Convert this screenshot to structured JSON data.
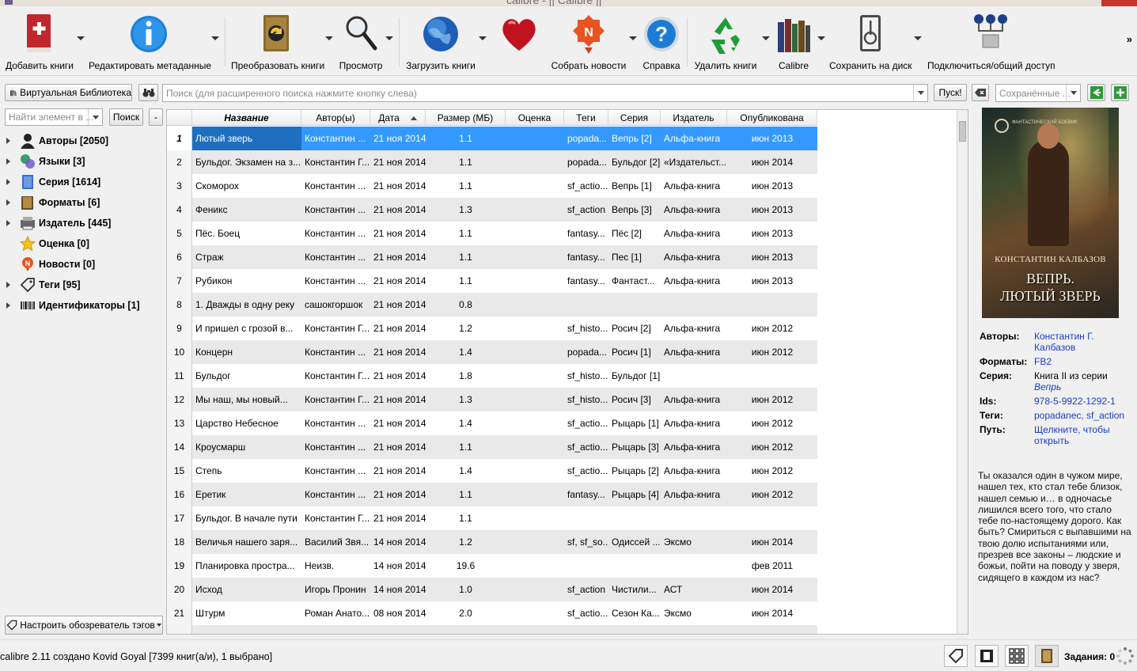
{
  "window": {
    "title": "calibre - || Calibre ||"
  },
  "toolbar": {
    "add_books": "Добавить книги",
    "edit_metadata": "Редактировать метаданные",
    "convert_books": "Преобразовать книги",
    "view": "Просмотр",
    "get_books": "Загрузить книги",
    "fetch_news": "Собрать новости",
    "help": "Справка",
    "remove_books": "Удалить книги",
    "calibre": "Calibre",
    "save_to_disk": "Сохранить на диск",
    "connect_share": "Подключиться/общий доступ",
    "more": "»"
  },
  "search": {
    "virtual_library": "Виртуальная Библиотека",
    "placeholder": "Поиск (для расширенного поиска нажмите кнопку слева)",
    "go": "Пуск!",
    "saved_placeholder": "Сохранённые ..."
  },
  "tag_browser": {
    "find_placeholder": "Найти элемент в ...",
    "find_button": "Поиск",
    "collapse_button": "-",
    "items": [
      {
        "label": "Авторы [2050]",
        "icon": "user-icon",
        "expandable": true
      },
      {
        "label": "Языки [3]",
        "icon": "languages-icon",
        "expandable": true
      },
      {
        "label": "Серия [1614]",
        "icon": "series-icon",
        "expandable": true
      },
      {
        "label": "Форматы [6]",
        "icon": "book-icon",
        "expandable": true
      },
      {
        "label": "Издатель [445]",
        "icon": "publisher-icon",
        "expandable": true
      },
      {
        "label": "Оценка [0]",
        "icon": "star-icon",
        "expandable": false
      },
      {
        "label": "Новости [0]",
        "icon": "news-icon",
        "expandable": false
      },
      {
        "label": "Теги [95]",
        "icon": "tag-icon",
        "expandable": true
      },
      {
        "label": "Идентификаторы [1]",
        "icon": "barcode-icon",
        "expandable": true
      }
    ],
    "configure_button": "Настроить обозреватель тэгов"
  },
  "table": {
    "columns": [
      "Название",
      "Автор(ы)",
      "Дата",
      "Размер (МБ)",
      "Оценка",
      "Теги",
      "Серия",
      "Издатель",
      "Опубликована"
    ],
    "rows": [
      {
        "n": "1",
        "title": "Лютый зверь",
        "author": "Константин ...",
        "date": "21 ноя 2014",
        "size": "1.1",
        "rating": "",
        "tags": "popada...",
        "series": "Вепрь [2]",
        "publisher": "Альфа-книга",
        "pub": "июн 2013"
      },
      {
        "n": "2",
        "title": "Бульдог. Экзамен на з...",
        "author": "Константин Г...",
        "date": "21 ноя 2014",
        "size": "1.1",
        "rating": "",
        "tags": "popada...",
        "series": "Бульдог [2]",
        "publisher": "«Издательст...",
        "pub": "июн 2014"
      },
      {
        "n": "3",
        "title": "Скоморох",
        "author": "Константин ...",
        "date": "21 ноя 2014",
        "size": "1.1",
        "rating": "",
        "tags": "sf_actio...",
        "series": "Вепрь [1]",
        "publisher": "Альфа-книга",
        "pub": "июн 2013"
      },
      {
        "n": "4",
        "title": "Феникс",
        "author": "Константин ...",
        "date": "21 ноя 2014",
        "size": "1.3",
        "rating": "",
        "tags": "sf_action",
        "series": "Вепрь [3]",
        "publisher": "Альфа-книга",
        "pub": "июн 2013"
      },
      {
        "n": "5",
        "title": "Пёс. Боец",
        "author": "Константин ...",
        "date": "21 ноя 2014",
        "size": "1.1",
        "rating": "",
        "tags": "fantasy...",
        "series": "Пёс [2]",
        "publisher": "Альфа-книга",
        "pub": "июн 2013"
      },
      {
        "n": "6",
        "title": "Страж",
        "author": "Константин ...",
        "date": "21 ноя 2014",
        "size": "1.1",
        "rating": "",
        "tags": "fantasy...",
        "series": "Пес [1]",
        "publisher": "Альфа-книга",
        "pub": "июн 2013"
      },
      {
        "n": "7",
        "title": "Рубикон",
        "author": "Константин ...",
        "date": "21 ноя 2014",
        "size": "1.1",
        "rating": "",
        "tags": "fantasy...",
        "series": "Фантаст...",
        "publisher": "Альфа-книга",
        "pub": "июн 2013"
      },
      {
        "n": "8",
        "title": "1. Дважды в одну реку",
        "author": "сашокгоршок",
        "date": "21 ноя 2014",
        "size": "0.8",
        "rating": "",
        "tags": "",
        "series": "",
        "publisher": "",
        "pub": ""
      },
      {
        "n": "9",
        "title": "И пришел с грозой в...",
        "author": "Константин Г...",
        "date": "21 ноя 2014",
        "size": "1.2",
        "rating": "",
        "tags": "sf_histo...",
        "series": "Росич [2]",
        "publisher": "Альфа-книга",
        "pub": "июн 2012"
      },
      {
        "n": "10",
        "title": "Концерн",
        "author": "Константин ...",
        "date": "21 ноя 2014",
        "size": "1.4",
        "rating": "",
        "tags": "popada...",
        "series": "Росич [1]",
        "publisher": "Альфа-книга",
        "pub": "июн 2012"
      },
      {
        "n": "11",
        "title": "Бульдог",
        "author": "Константин Г...",
        "date": "21 ноя 2014",
        "size": "1.8",
        "rating": "",
        "tags": "sf_histo...",
        "series": "Бульдог [1]",
        "publisher": "",
        "pub": ""
      },
      {
        "n": "12",
        "title": "Мы наш, мы новый...",
        "author": "Константин Г...",
        "date": "21 ноя 2014",
        "size": "1.3",
        "rating": "",
        "tags": "sf_histo...",
        "series": "Росич [3]",
        "publisher": "Альфа-книга",
        "pub": "июн 2012"
      },
      {
        "n": "13",
        "title": "Царство Небесное",
        "author": "Константин ...",
        "date": "21 ноя 2014",
        "size": "1.4",
        "rating": "",
        "tags": "sf_actio...",
        "series": "Рыцарь [1]",
        "publisher": "Альфа-книга",
        "pub": "июн 2012"
      },
      {
        "n": "14",
        "title": "Кроусмарш",
        "author": "Константин ...",
        "date": "21 ноя 2014",
        "size": "1.1",
        "rating": "",
        "tags": "sf_actio...",
        "series": "Рыцарь [3]",
        "publisher": "Альфа-книга",
        "pub": "июн 2012"
      },
      {
        "n": "15",
        "title": "Степь",
        "author": "Константин ...",
        "date": "21 ноя 2014",
        "size": "1.4",
        "rating": "",
        "tags": "sf_actio...",
        "series": "Рыцарь [2]",
        "publisher": "Альфа-книга",
        "pub": "июн 2012"
      },
      {
        "n": "16",
        "title": "Еретик",
        "author": "Константин ...",
        "date": "21 ноя 2014",
        "size": "1.1",
        "rating": "",
        "tags": "fantasy...",
        "series": "Рыцарь [4]",
        "publisher": "Альфа-книга",
        "pub": "июн 2012"
      },
      {
        "n": "17",
        "title": "Бульдог. В начале пути",
        "author": "Константин Г...",
        "date": "21 ноя 2014",
        "size": "1.1",
        "rating": "",
        "tags": "",
        "series": "",
        "publisher": "",
        "pub": ""
      },
      {
        "n": "18",
        "title": "Величья нашего заря...",
        "author": "Василий Звя...",
        "date": "14 ноя 2014",
        "size": "1.2",
        "rating": "",
        "tags": "sf, sf_so...",
        "series": "Одиссей ...",
        "publisher": "Эксмо",
        "pub": "июн 2014"
      },
      {
        "n": "19",
        "title": "Планировка простра...",
        "author": "Неизв.",
        "date": "14 ноя 2014",
        "size": "19.6",
        "rating": "",
        "tags": "",
        "series": "",
        "publisher": "",
        "pub": "фев 2011"
      },
      {
        "n": "20",
        "title": "Исход",
        "author": "Игорь Пронин",
        "date": "14 ноя 2014",
        "size": "1.0",
        "rating": "",
        "tags": "sf_action",
        "series": "Чистили...",
        "publisher": "АСТ",
        "pub": "июн 2014"
      },
      {
        "n": "21",
        "title": "Штурм",
        "author": "Роман Анато...",
        "date": "08 ноя 2014",
        "size": "2.0",
        "rating": "",
        "tags": "sf_actio...",
        "series": "Сезон Ка...",
        "publisher": "Эксмо",
        "pub": "июн 2014"
      }
    ]
  },
  "details": {
    "cover": {
      "author": "КОНСТАНТИН КАЛБАЗОВ",
      "title_line1": "ВЕПРЬ.",
      "title_line2": "ЛЮТЫЙ ЗВЕРЬ",
      "logo_text": "ФАНТАСТИЧЕСКИЙ БОЕВИК"
    },
    "authors_label": "Авторы:",
    "authors_value": "Константин Г. Калбазов",
    "formats_label": "Форматы:",
    "formats_value": "FB2",
    "series_label": "Серия:",
    "series_prefix": "Книга II из серии",
    "series_value": "Вепрь",
    "ids_label": "Ids:",
    "ids_value": "978-5-9922-1292-1",
    "tags_label": "Теги:",
    "tags_value": "popadanec, sf_action",
    "path_label": "Путь:",
    "path_value": "Щелкните, чтобы открыть",
    "description": "Ты оказался один в чужом мире, нашел тех, кто стал тебе близок, нашел семью и… в одночасье лишился всего того, что стало тебе по-настоящему дорого. Как быть? Смириться с выпавшими на твою долю испытаниями или, презрев все законы – людские и божьи, пойти на поводу у зверя, сидящего в каждом из нас?"
  },
  "statusbar": {
    "text": "calibre 2.11 создано Kovid Goyal   [7399 книг(а/и), 1 выбрано]",
    "jobs": "Задания: 0"
  },
  "colors": {
    "selection": "#3399ff",
    "link": "#1a3cc8",
    "alt_row": "#e9e9e9"
  }
}
